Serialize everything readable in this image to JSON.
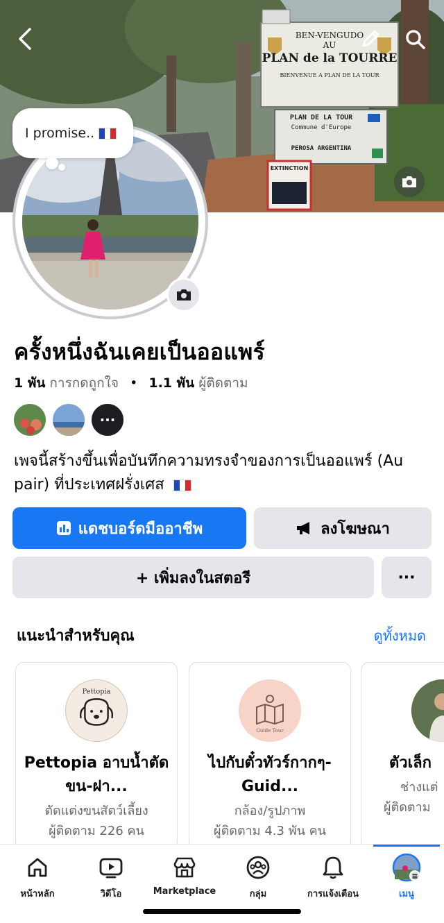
{
  "cover": {
    "sign_main_lines": [
      "BEN-VENGUDO",
      "AU",
      "PLAN de la TOURRE",
      "BIENVENUE A PLAN DE LA TOUR"
    ],
    "sign_secondary_lines": [
      "PLAN DE LA TOUR",
      "Commune d'Europe",
      "PEROSA ARGENTINA"
    ],
    "sign_small": "EXTINCTION"
  },
  "note": {
    "text": "I promise.."
  },
  "page": {
    "name": "ครั้งหนึ่งฉันเคยเป็นออแพร์",
    "likes_count": "1 พัน",
    "likes_label": "การกดถูกใจ",
    "followers_count": "1.1 พัน",
    "followers_label": "ผู้ติดตาม",
    "bio": "เพจนี้สร้างขึ้นเพื่อบันทึกความทรงจำของการเป็นออแพร์ (Au pair) ที่ประเทศฝรั่งเศส"
  },
  "actions": {
    "dashboard_label": "แดชบอร์ดมืออาชีพ",
    "ads_label": "ลงโฆษณา",
    "story_label": "+ เพิ่มลงในสตอรี",
    "more_label": "···"
  },
  "suggestions": {
    "title": "แนะนำสำหรับคุณ",
    "see_all": "ดูทั้งหมด",
    "cards": [
      {
        "name": "Pettopia อาบน้ำตัดขน-ฝา...",
        "category": "ตัดแต่งขนสัตว์เลี้ยง",
        "followers": "ผู้ติดตาม 226 คน",
        "logo_text": "Pettopia"
      },
      {
        "name": "ไปกับตั๋วทัวร์กากๆ-Guid...",
        "category": "กล้อง/รูปภาพ",
        "followers": "ผู้ติดตาม 4.3 พัน คน",
        "logo_text": "Guide Tour"
      },
      {
        "name": "ตัวเล็ก",
        "category": "ช่างแต่",
        "followers": "ผู้ติดตาม"
      }
    ]
  },
  "tabbar": {
    "items": [
      {
        "label": "หน้าหลัก",
        "icon": "home-icon"
      },
      {
        "label": "วิดีโอ",
        "icon": "video-icon"
      },
      {
        "label": "Marketplace",
        "icon": "marketplace-icon"
      },
      {
        "label": "กลุ่ม",
        "icon": "groups-icon"
      },
      {
        "label": "การแจ้งเตือน",
        "icon": "bell-icon"
      },
      {
        "label": "เมนู",
        "icon": "menu-avatar-icon"
      }
    ],
    "active_index": 5
  },
  "colors": {
    "accent": "#1877f2",
    "button_gray": "#e4e6eb",
    "muted_text": "#65676b"
  }
}
